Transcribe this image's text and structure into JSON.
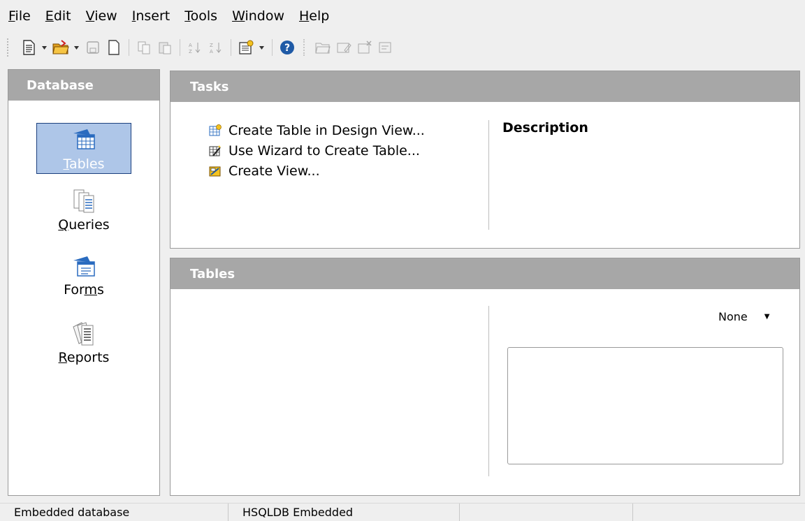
{
  "menubar": {
    "items": [
      {
        "pre": "",
        "mn": "F",
        "post": "ile"
      },
      {
        "pre": "",
        "mn": "E",
        "post": "dit"
      },
      {
        "pre": "",
        "mn": "V",
        "post": "iew"
      },
      {
        "pre": "",
        "mn": "I",
        "post": "nsert"
      },
      {
        "pre": "",
        "mn": "T",
        "post": "ools"
      },
      {
        "pre": "",
        "mn": "W",
        "post": "indow"
      },
      {
        "pre": "",
        "mn": "H",
        "post": "elp"
      }
    ]
  },
  "toolbar": {
    "icons": [
      "new-document-icon",
      "open-folder-icon",
      "save-icon",
      "blank-page-icon",
      "copy-icon",
      "paste-icon",
      "sort-ascending-icon",
      "sort-descending-icon",
      "form-design-icon",
      "help-icon",
      "open-object-icon",
      "edit-object-icon",
      "delete-object-icon",
      "rename-object-icon"
    ]
  },
  "leftpanel": {
    "title": "Database",
    "items": [
      {
        "pre": "",
        "mn": "T",
        "post": "ables",
        "icon": "table-icon",
        "selected": true
      },
      {
        "pre": "",
        "mn": "Q",
        "post": "ueries",
        "icon": "query-icon",
        "selected": false
      },
      {
        "pre": "For",
        "mn": "m",
        "post": "s",
        "icon": "form-icon",
        "selected": false
      },
      {
        "pre": "",
        "mn": "R",
        "post": "eports",
        "icon": "report-icon",
        "selected": false
      }
    ]
  },
  "tasks": {
    "title": "Tasks",
    "items": [
      {
        "label": "Create Table in Design View...",
        "icon": "design-view-icon"
      },
      {
        "label": "Use Wizard to Create Table...",
        "icon": "wizard-icon"
      },
      {
        "label": "Create View...",
        "icon": "create-view-icon"
      }
    ],
    "description_title": "Description"
  },
  "tables": {
    "title": "Tables",
    "preview_selected": "None"
  },
  "statusbar": {
    "cells": [
      "Embedded database",
      "HSQLDB Embedded",
      "",
      ""
    ]
  },
  "colors": {
    "header_bg": "#a7a7a7",
    "selection_bg": "#aec6e8",
    "selection_border": "#1b3f7e",
    "panel_bg": "#ffffff",
    "window_bg": "#efefef"
  }
}
